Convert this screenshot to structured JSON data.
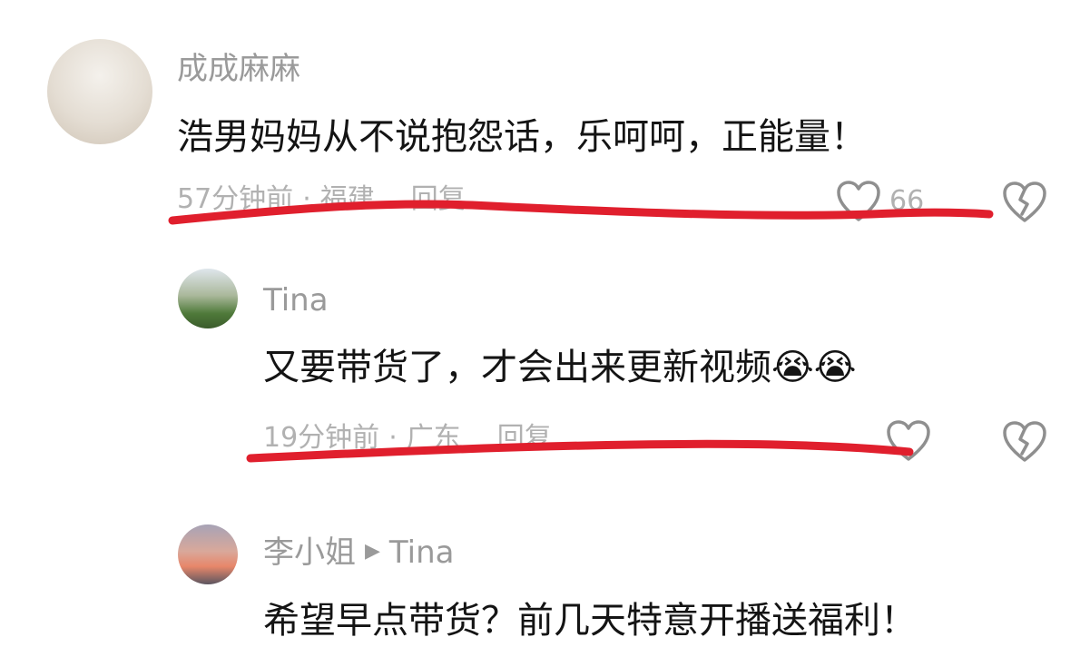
{
  "comments": [
    {
      "username": "成成麻麻",
      "text": "浩男妈妈从不说抱怨话，乐呵呵，正能量！",
      "time": "57分钟前",
      "location": "福建",
      "reply_label": "回复",
      "likes": "66"
    },
    {
      "username": "Tina",
      "text": "又要带货了，才会出来更新视频",
      "emojis": "😭😭",
      "time": "19分钟前",
      "location": "广东",
      "reply_label": "回复",
      "likes": ""
    },
    {
      "username": "李小姐",
      "reply_to": "Tina",
      "text": "希望早点带货？前几天特意开播送福利！"
    }
  ],
  "icons": {
    "like": "heart-outline-icon",
    "dislike": "broken-heart-icon",
    "reply_arrow": "play-right-arrow-icon"
  },
  "colors": {
    "username": "#9a9a9a",
    "meta": "#b1b1b1",
    "text": "#141414",
    "annotation": "#e01f2d"
  }
}
